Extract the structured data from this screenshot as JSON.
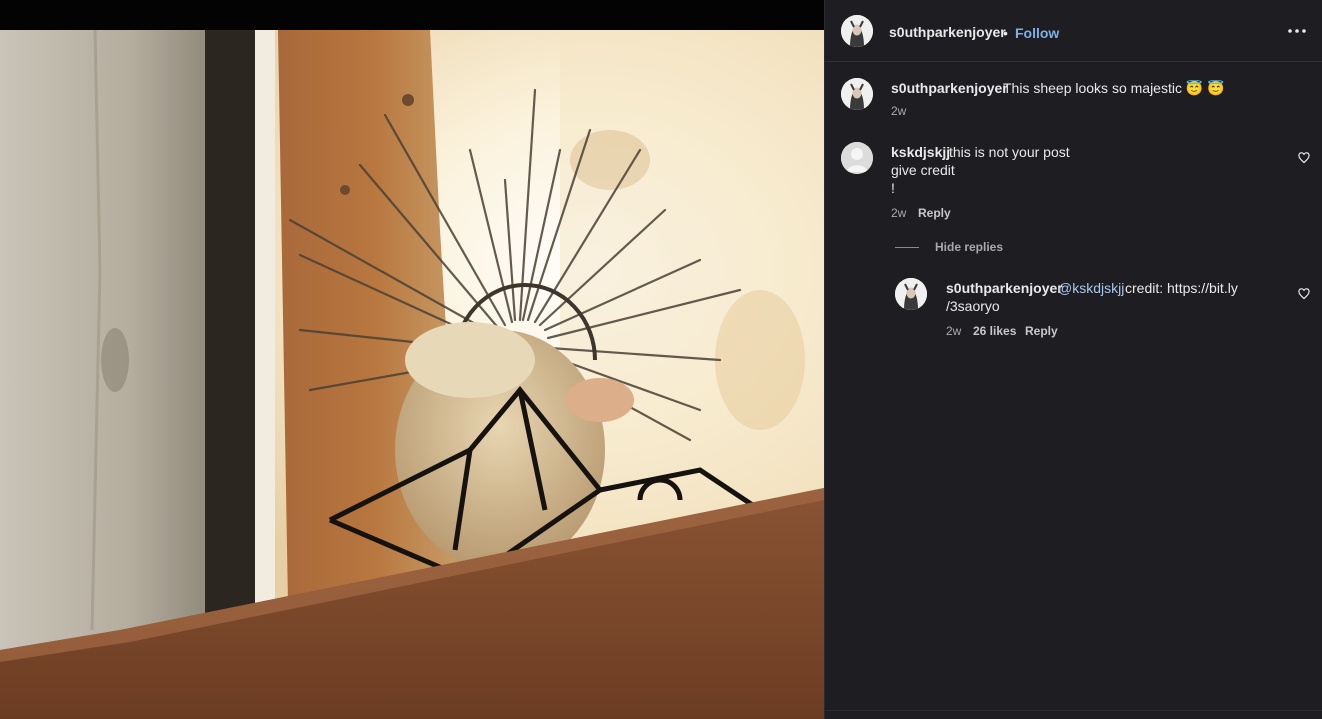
{
  "header": {
    "username": "s0uthparkenjoyer",
    "separator": "•",
    "follow_label": "Follow",
    "more_icon": "more-horizontal-icon"
  },
  "caption": {
    "username": "s0uthparkenjoyer",
    "text": "This sheep looks so majestic 😇 😇",
    "time": "2w"
  },
  "comments": [
    {
      "username": "kskdjskjj",
      "lines": [
        "this is not your post",
        "give credit",
        "!"
      ],
      "time": "2w",
      "reply_label": "Reply",
      "like_icon": "heart-icon",
      "hide_replies_label": "Hide replies",
      "replies": [
        {
          "username": "s0uthparkenjoyer",
          "mention": "@kskdjskjj",
          "text_line1": "credit: https://bit.ly",
          "text_line2": "/3saoryo",
          "time": "2w",
          "likes": "26 likes",
          "reply_label": "Reply",
          "like_icon": "heart-icon"
        }
      ]
    }
  ],
  "colors": {
    "panel_bg": "#1e1e22",
    "link_blue": "#7fb0e6",
    "mention_blue": "#a7c8ee"
  }
}
